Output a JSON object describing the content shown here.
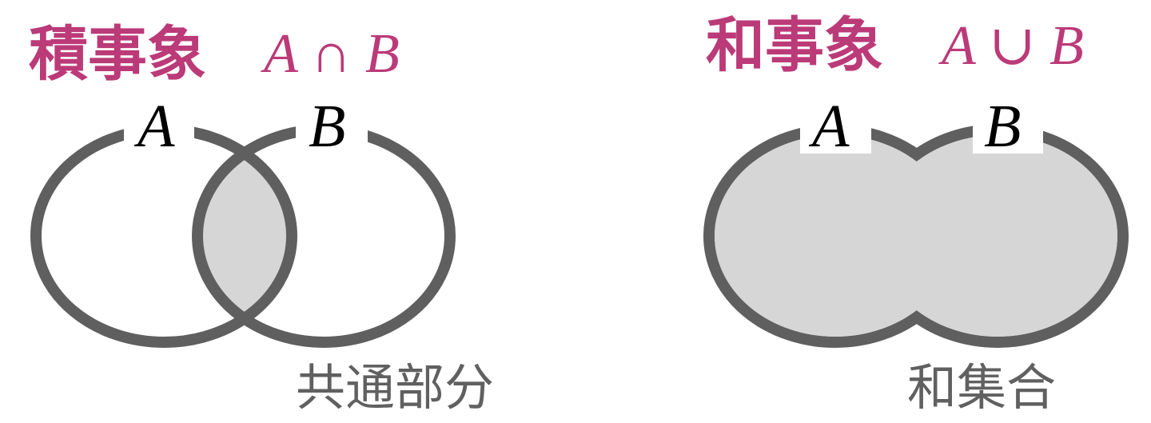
{
  "colors": {
    "title": "#bb3a78",
    "stroke": "#5f5f5f",
    "fill": "#d6d6d6",
    "caption": "#606060"
  },
  "left": {
    "title": "積事象",
    "math": "A ∩ B",
    "label_a": "A",
    "label_b": "B",
    "caption": "共通部分"
  },
  "right": {
    "title": "和事象",
    "math": "A ∪ B",
    "label_a": "A",
    "label_b": "B",
    "caption": "和集合"
  }
}
